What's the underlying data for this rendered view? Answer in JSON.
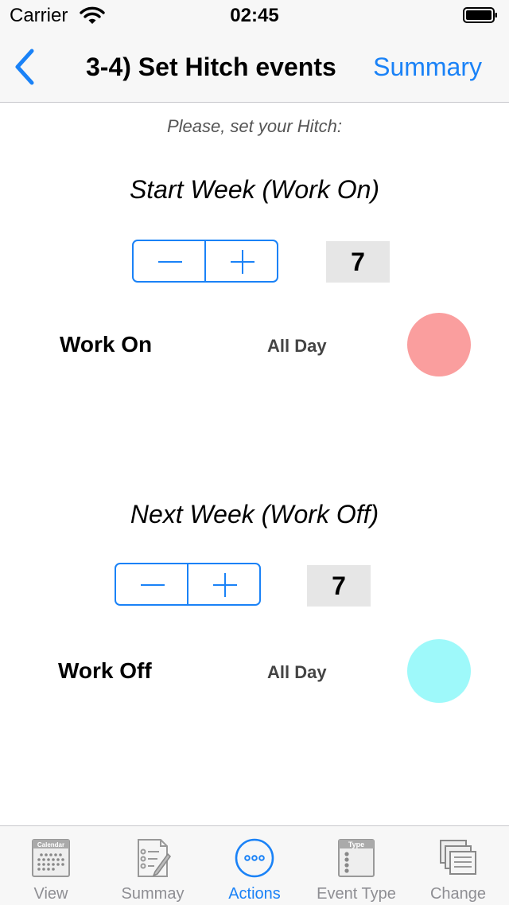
{
  "status_bar": {
    "carrier": "Carrier",
    "time": "02:45"
  },
  "nav": {
    "title": "3-4) Set Hitch events",
    "right_button": "Summary"
  },
  "instruction": "Please, set your Hitch:",
  "sections": [
    {
      "title": "Start Week (Work On)",
      "value": "7",
      "event_label": "Work On",
      "time_label": "All Day",
      "color": "#fa9e9e"
    },
    {
      "title": "Next Week (Work Off)",
      "value": "7",
      "event_label": "Work Off",
      "time_label": "All Day",
      "color": "#9ef9fa"
    }
  ],
  "tabs": [
    {
      "label": "View",
      "icon": "calendar-icon",
      "calendar_text": "Calendar"
    },
    {
      "label": "Summay",
      "icon": "checklist-icon"
    },
    {
      "label": "Actions",
      "icon": "ellipsis-circle-icon",
      "active": true
    },
    {
      "label": "Event Type",
      "icon": "event-type-icon",
      "type_text": "Type"
    },
    {
      "label": "Change",
      "icon": "documents-icon"
    }
  ],
  "colors": {
    "accent": "#1a82f7",
    "bar_background": "#f7f7f7",
    "inactive_tab": "#8e8e93",
    "value_box": "#e6e6e6"
  }
}
